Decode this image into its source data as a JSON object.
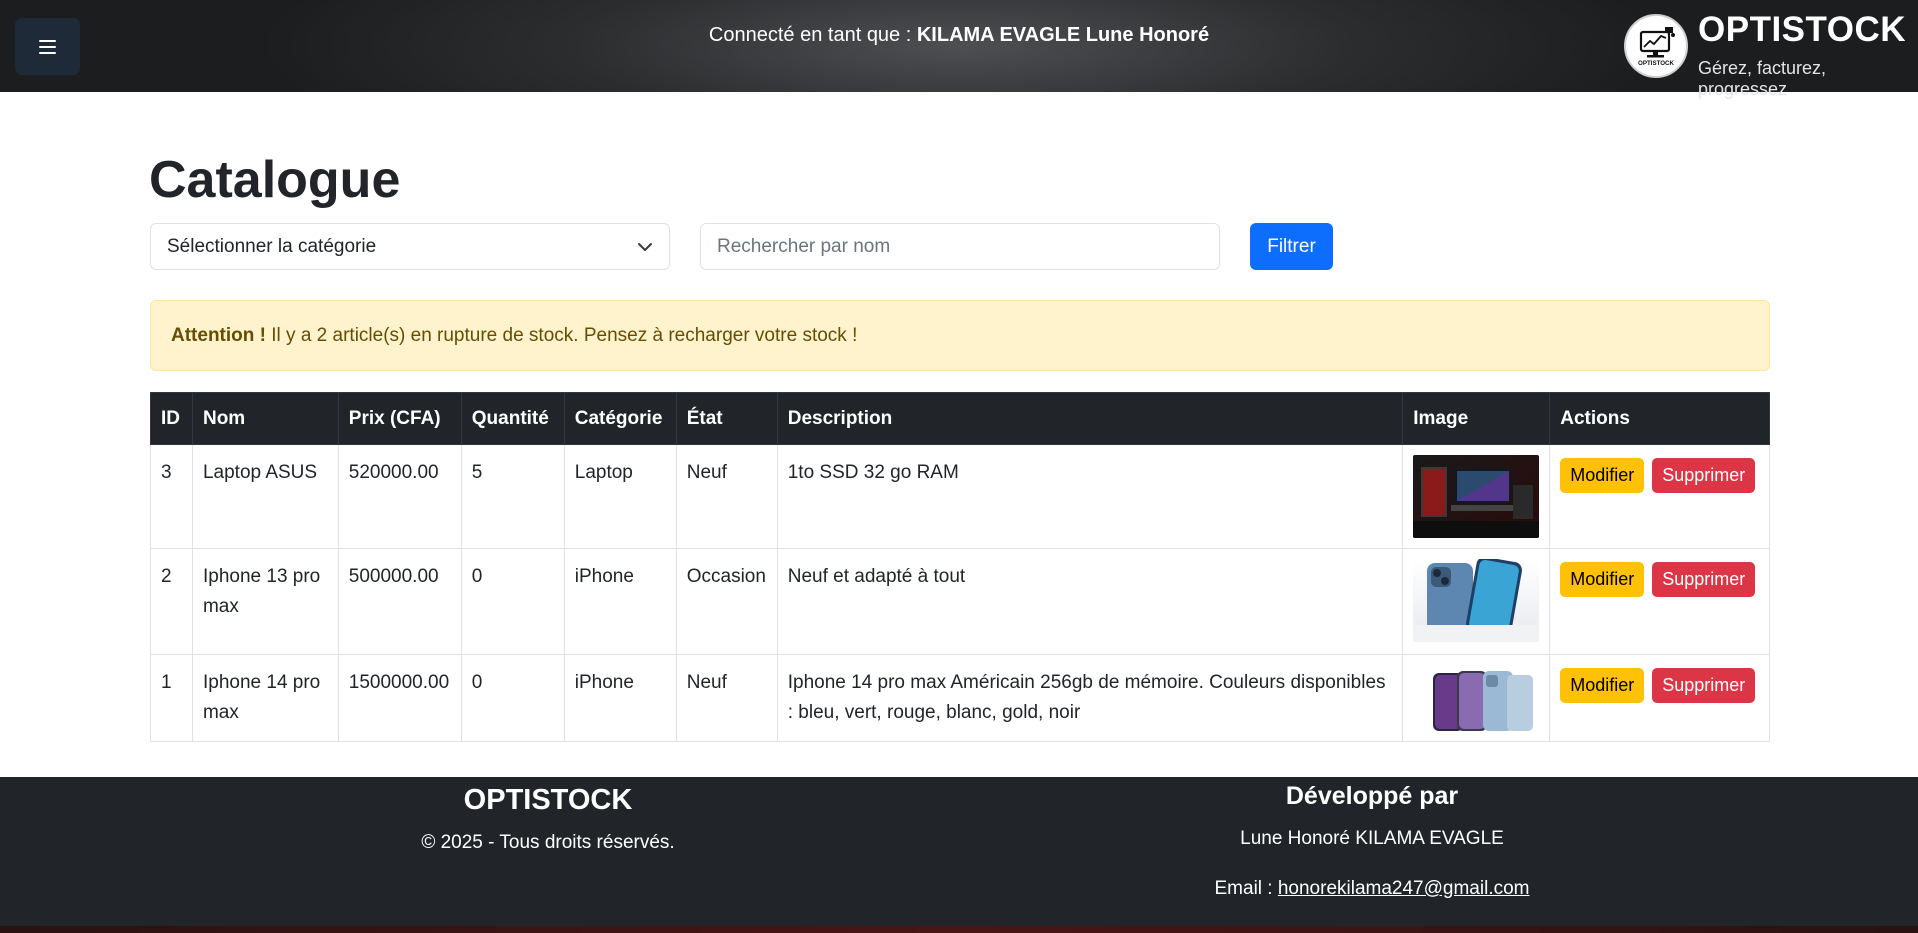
{
  "header": {
    "menu_icon": "hamburger-menu-icon",
    "connected_prefix": "Connecté en tant que :",
    "user_name": "KILAMA EVAGLE Lune Honoré",
    "brand_name": "OPTISTOCK",
    "brand_tagline": "Gérez, facturez, progressez",
    "logo_text": "OPTISTOCK"
  },
  "main": {
    "title": "Catalogue",
    "category_select": {
      "selected": "Sélectionner la catégorie"
    },
    "search": {
      "placeholder": "Rechercher par nom",
      "value": ""
    },
    "filter_button": "Filtrer",
    "alert": {
      "strong": "Attention !",
      "text": "Il y a 2 article(s) en rupture de stock. Pensez à recharger votre stock !"
    }
  },
  "table": {
    "headers": [
      "ID",
      "Nom",
      "Prix (CFA)",
      "Quantité",
      "Catégorie",
      "État",
      "Description",
      "Image",
      "Actions"
    ],
    "rows": [
      {
        "id": "3",
        "nom": "Laptop ASUS",
        "prix": "520000.00",
        "quantite": "5",
        "categorie": "Laptop",
        "etat": "Neuf",
        "description": "1to SSD 32 go RAM",
        "image": "laptop-product-image",
        "edit": "Modifier",
        "delete": "Supprimer"
      },
      {
        "id": "2",
        "nom": "Iphone 13 pro max",
        "prix": "500000.00",
        "quantite": "0",
        "categorie": "iPhone",
        "etat": "Occasion",
        "description": "Neuf et adapté à tout",
        "image": "iphone-13-product-image",
        "edit": "Modifier",
        "delete": "Supprimer"
      },
      {
        "id": "1",
        "nom": "Iphone 14 pro max",
        "prix": "1500000.00",
        "quantite": "0",
        "categorie": "iPhone",
        "etat": "Neuf",
        "description": "Iphone 14 pro max Américain 256gb de mémoire. Couleurs disponibles : bleu, vert, rouge, blanc, gold, noir",
        "image": "iphone-14-product-image",
        "edit": "Modifier",
        "delete": "Supprimer"
      }
    ]
  },
  "footer": {
    "brand": "OPTISTOCK",
    "copyright": "© 2025 - Tous droits réservés.",
    "developed_by": "Développé par",
    "developer_name": "Lune Honoré KILAMA EVAGLE",
    "email_label": "Email :",
    "email": "honorekilama247@gmail.com"
  },
  "colors": {
    "primary": "#0d6efd",
    "warning": "#ffc107",
    "danger": "#dc3545",
    "dark": "#212529",
    "alert_bg": "#fff3cd",
    "alert_text": "#664d03"
  }
}
